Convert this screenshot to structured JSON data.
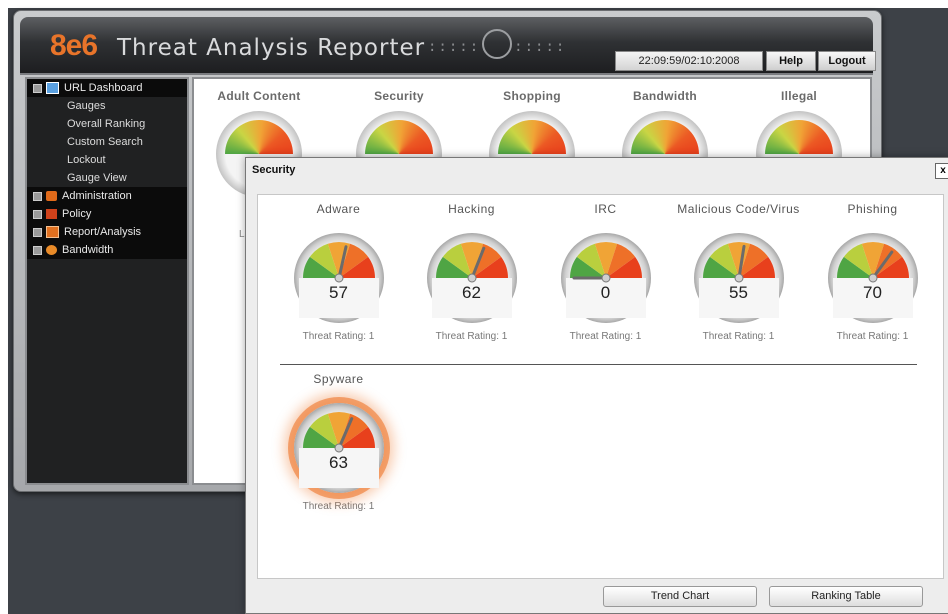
{
  "app": {
    "logo": "8e6",
    "title": "Threat Analysis Reporter",
    "datetime": "22:09:59/02:10:2008",
    "help_label": "Help",
    "logout_label": "Logout"
  },
  "sidebar": {
    "sections": [
      {
        "label": "URL Dashboard",
        "icon": "dashboard-icon",
        "children": [
          "Gauges",
          "Overall Ranking",
          "Custom Search",
          "Lockout",
          "Gauge View"
        ]
      },
      {
        "label": "Administration",
        "icon": "administration-icon"
      },
      {
        "label": "Policy",
        "icon": "policy-icon"
      },
      {
        "label": "Report/Analysis",
        "icon": "report-icon"
      },
      {
        "label": "Bandwidth",
        "icon": "bandwidth-icon"
      }
    ]
  },
  "dashboard": {
    "gauges": [
      "Adult Content",
      "Security",
      "Shopping",
      "Bandwidth",
      "Illegal"
    ],
    "last_label": "Last"
  },
  "popup": {
    "title": "Security",
    "close_label": "x",
    "gauges": [
      {
        "name": "Adware",
        "value": 57,
        "rating": "Threat Rating: 1"
      },
      {
        "name": "Hacking",
        "value": 62,
        "rating": "Threat Rating: 1"
      },
      {
        "name": "IRC",
        "value": 0,
        "rating": "Threat Rating: 1"
      },
      {
        "name": "Malicious Code/Virus",
        "value": 55,
        "rating": "Threat Rating: 1"
      },
      {
        "name": "Phishing",
        "value": 70,
        "rating": "Threat Rating: 1"
      },
      {
        "name": "Spyware",
        "value": 63,
        "rating": "Threat Rating: 1",
        "alert": true
      }
    ],
    "trend_chart_label": "Trend Chart",
    "ranking_table_label": "Ranking Table"
  },
  "colors": {
    "logo": "#e8742a",
    "gauge_green": "#4fa544",
    "gauge_yellow": "#f0a436",
    "gauge_red": "#e8401c",
    "alert_glow": "#ec6e1e"
  }
}
